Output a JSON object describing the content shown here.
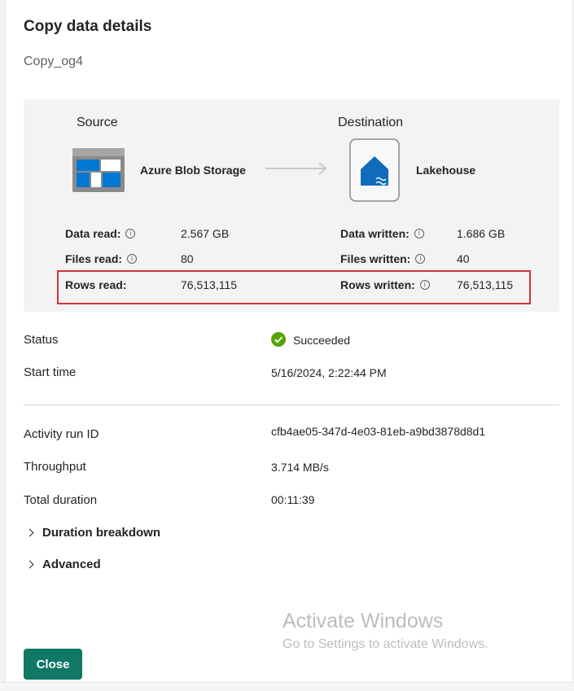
{
  "dialog": {
    "title": "Copy data details",
    "activity_name": "Copy_og4"
  },
  "source": {
    "heading": "Source",
    "name": "Azure Blob Storage",
    "icon": "azure-blob-storage-icon",
    "stats": [
      {
        "label": "Data read:",
        "value": "2.567 GB",
        "info": true
      },
      {
        "label": "Files read:",
        "value": "80",
        "info": true
      },
      {
        "label": "Rows read:",
        "value": "76,513,115",
        "info": false
      }
    ]
  },
  "destination": {
    "heading": "Destination",
    "name": "Lakehouse",
    "icon": "lakehouse-icon",
    "stats": [
      {
        "label": "Data written:",
        "value": "1.686 GB",
        "info": true
      },
      {
        "label": "Files written:",
        "value": "40",
        "info": true
      },
      {
        "label": "Rows written:",
        "value": "76,513,115",
        "info": true
      }
    ]
  },
  "status": {
    "label": "Status",
    "value": "Succeeded",
    "icon": "success-check-icon",
    "color": "#57a300"
  },
  "start_time": {
    "label": "Start time",
    "value": "5/16/2024, 2:22:44 PM"
  },
  "details": {
    "activity_run_id": {
      "label": "Activity run ID",
      "value": "cfb4ae05-347d-4e03-81eb-a9bd3878d8d1"
    },
    "throughput": {
      "label": "Throughput",
      "value": "3.714 MB/s"
    },
    "total_duration": {
      "label": "Total duration",
      "value": "00:11:39"
    }
  },
  "expanders": {
    "duration_breakdown": "Duration breakdown",
    "advanced": "Advanced"
  },
  "footer": {
    "close_label": "Close",
    "button_color": "#117865"
  },
  "watermark": {
    "title": "Activate Windows",
    "subtitle": "Go to Settings to activate Windows."
  },
  "highlight_color": "#d13438"
}
